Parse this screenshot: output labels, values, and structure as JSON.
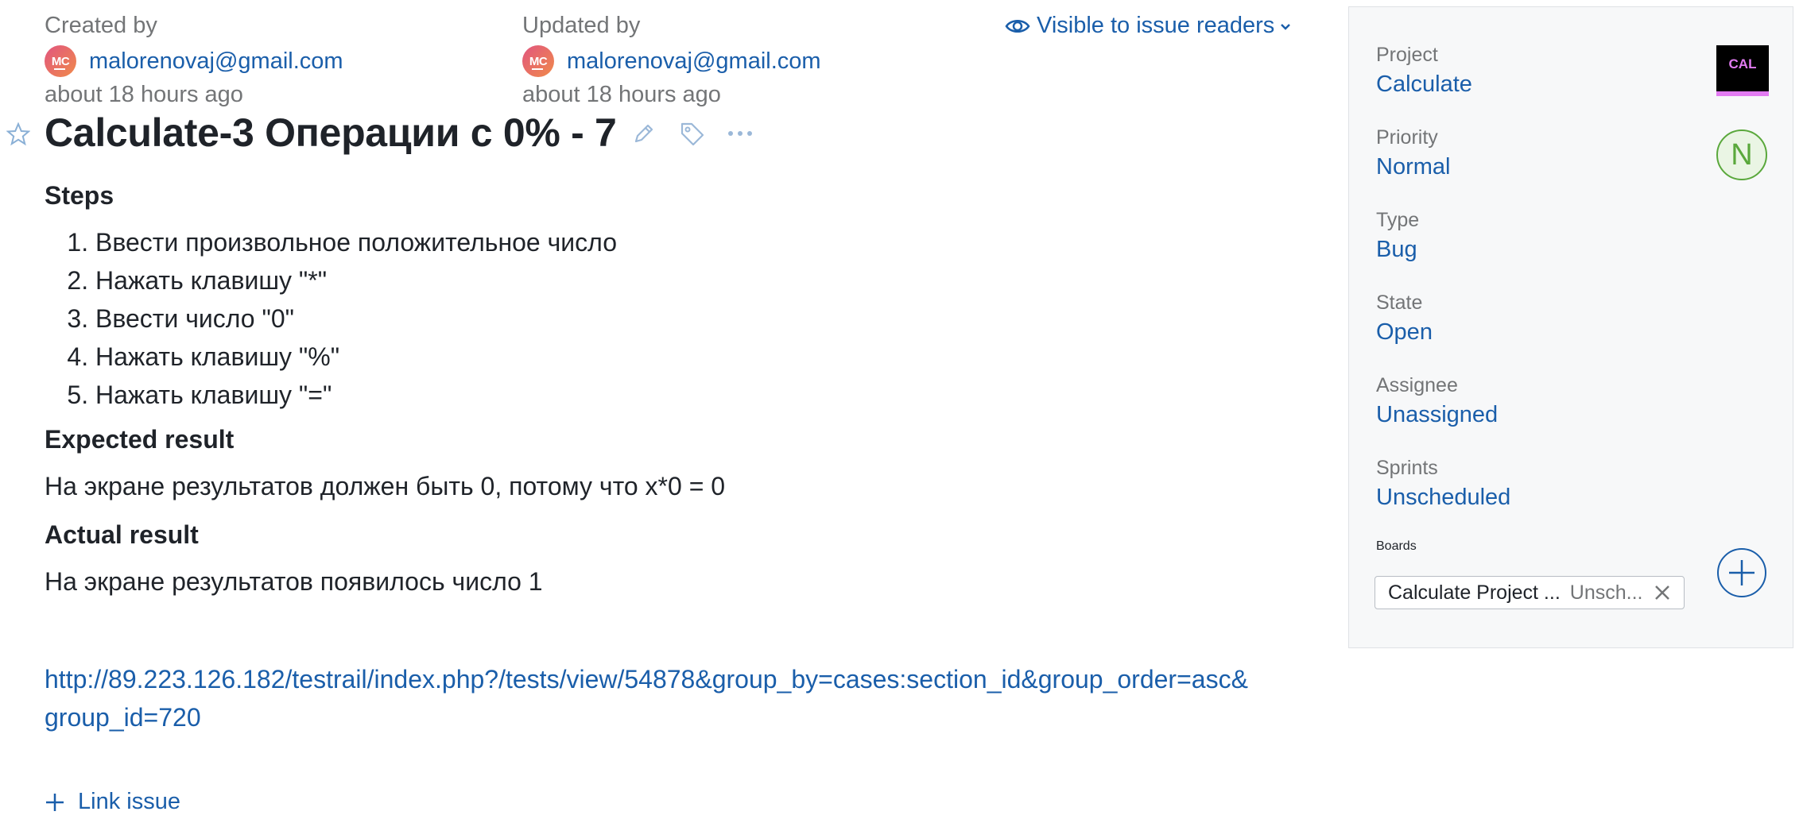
{
  "meta": {
    "created_label": "Created by",
    "created_email": "malorenovaj@gmail.com",
    "created_ago": "about 18 hours ago",
    "updated_label": "Updated by",
    "updated_email": "malorenovaj@gmail.com",
    "updated_ago": "about 18 hours ago",
    "avatar_initials": "MC",
    "visibility": "Visible to issue readers"
  },
  "issue": {
    "title": "Calculate-3 Операции с 0% - 7",
    "steps_heading": "Steps",
    "steps": [
      "Ввести произвольное положительное число",
      "Нажать клавишу \"*\"",
      "Ввести число \"0\"",
      "Нажать клавишу \"%\"",
      "Нажать клавишу \"=\""
    ],
    "expected_heading": "Expected result",
    "expected_text": "На экране результатов должен быть 0, потому что x*0 = 0",
    "actual_heading": "Actual result",
    "actual_text": "На экране результатов появилось число 1",
    "link_line1": "http://89.223.126.182/testrail/index.php?/tests/view/54878&group_by=cases:section_id&group_order=asc&",
    "link_line2": "group_id=720",
    "link_issue_label": "Link issue"
  },
  "sidebar": {
    "project_label": "Project",
    "project_value": "Calculate",
    "project_logo_text": "CAL",
    "priority_label": "Priority",
    "priority_value": "Normal",
    "priority_badge": "N",
    "type_label": "Type",
    "type_value": "Bug",
    "state_label": "State",
    "state_value": "Open",
    "assignee_label": "Assignee",
    "assignee_value": "Unassigned",
    "sprints_label": "Sprints",
    "sprints_value": "Unscheduled",
    "boards_label": "Boards",
    "board_name": "Calculate Project ...",
    "board_sprint": "Unsch..."
  },
  "colors": {
    "link": "#1a5eaa",
    "priority_green": "#5aa83c",
    "logo_bg": "#000000",
    "logo_text": "#e27bf2"
  }
}
